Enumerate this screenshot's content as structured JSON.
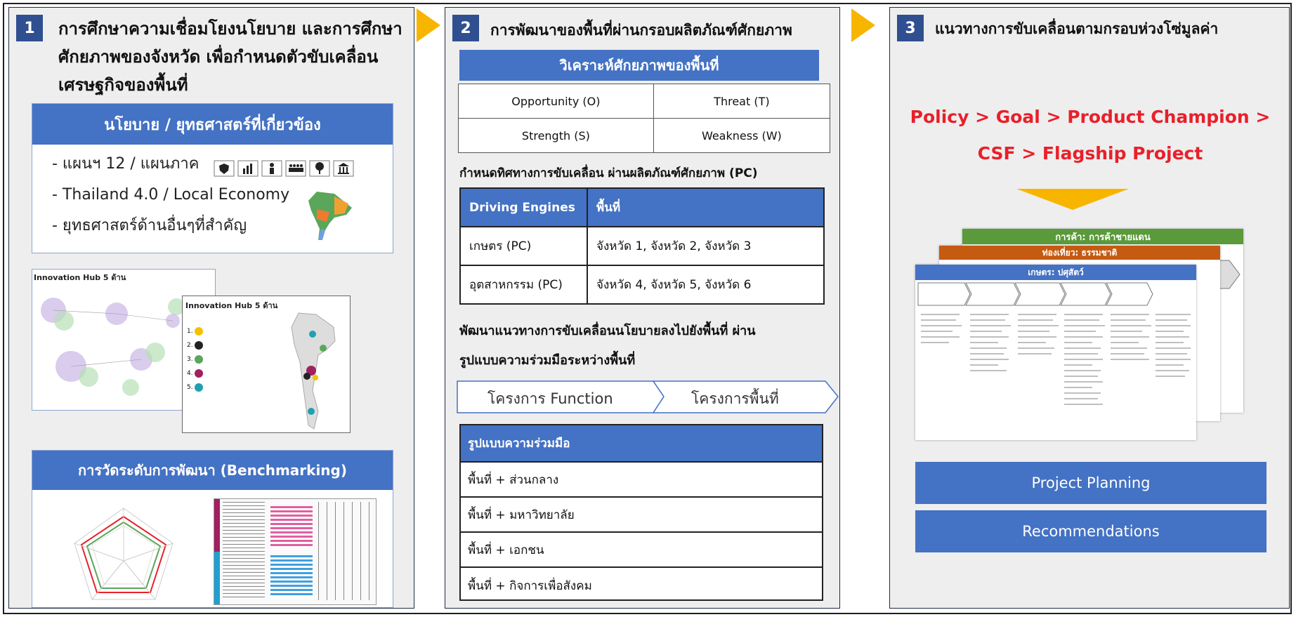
{
  "panel1": {
    "number": "1",
    "title_lines": [
      "การศึกษาความเชื่อมโยงนโยบาย และการศึกษา",
      "ศักยภาพของจังหวัด เพื่อกำหนดตัวขับเคลื่อน",
      "เศรษฐกิจของพื้นที่"
    ],
    "policy_header": "นโยบาย / ยุทธศาสตร์ที่เกี่ยวข้อง",
    "policy_items": [
      "- แผนฯ 12 / แผนภาค",
      "- Thailand 4.0 / Local Economy",
      "- ยุทธศาสตร์ด้านอื่นๆที่สำคัญ"
    ],
    "hub_caption": "Innovation Hub 5 ด้าน",
    "hub_caption2": "Innovation Hub 5 ด้าน",
    "hub_list": [
      "1.",
      "2.",
      "3.",
      "4.",
      "5."
    ],
    "benchmark_header": "การวัดระดับการพัฒนา (Benchmarking)"
  },
  "panel2": {
    "number": "2",
    "title": "การพัฒนาของพื้นที่ผ่านกรอบผลิตภัณฑ์ศักยภาพ",
    "analysis_header": "วิเคราะห์ศักยภาพของพื้นที่",
    "swot": [
      [
        "Opportunity (O)",
        "Threat (T)"
      ],
      [
        "Strength (S)",
        "Weakness (W)"
      ]
    ],
    "direction_text": "กำหนดทิศทางการขับเคลื่อน ผ่านผลิตภัณฑ์ศักยภาพ (PC)",
    "engines_headers": [
      "Driving Engines",
      "พื้นที่"
    ],
    "engines_rows": [
      [
        "เกษตร (PC)",
        "จังหวัด 1, จังหวัด 2, จังหวัด 3"
      ],
      [
        "อุตสาหกรรม (PC)",
        "จังหวัด 4, จังหวัด 5, จังหวัด 6"
      ]
    ],
    "policy_text_lines": [
      "พัฒนาแนวทางการขับเคลื่อนนโยบายลงไปยังพื้นที่ ผ่าน",
      "รูปแบบความร่วมมือระหว่างพื้นที่"
    ],
    "step_function": "โครงการ Function",
    "step_area": "โครงการพื้นที่",
    "coop_header": "รูปแบบความร่วมมือ",
    "coop_rows": [
      "พื้นที่ + ส่วนกลาง",
      "พื้นที่ + มหาวิทยาลัย",
      "พื้นที่ + เอกชน",
      "พื้นที่ + กิจการเพื่อสังคม"
    ]
  },
  "panel3": {
    "number": "3",
    "title": "แนวทางการขับเคลื่อนตามกรอบห่วงโซ่มูลค่า",
    "red_lines": [
      "Policy > Goal > Product Champion >",
      "CSF > Flagship Project"
    ],
    "vc_doc1": "การค้า: การค้าชายแดน",
    "vc_doc2": "ท่องเที่ยว: ธรรมชาติ",
    "vc_doc3": "เกษตร: ปศุสัตว์",
    "button_planning": "Project Planning",
    "button_recommend": "Recommendations"
  },
  "colors": {
    "accent_blue": "#4472c4",
    "badge_blue": "#2f4f90",
    "arrow_yellow": "#f7b500",
    "red": "#e8202a",
    "panel_bg": "#eeeeee"
  }
}
